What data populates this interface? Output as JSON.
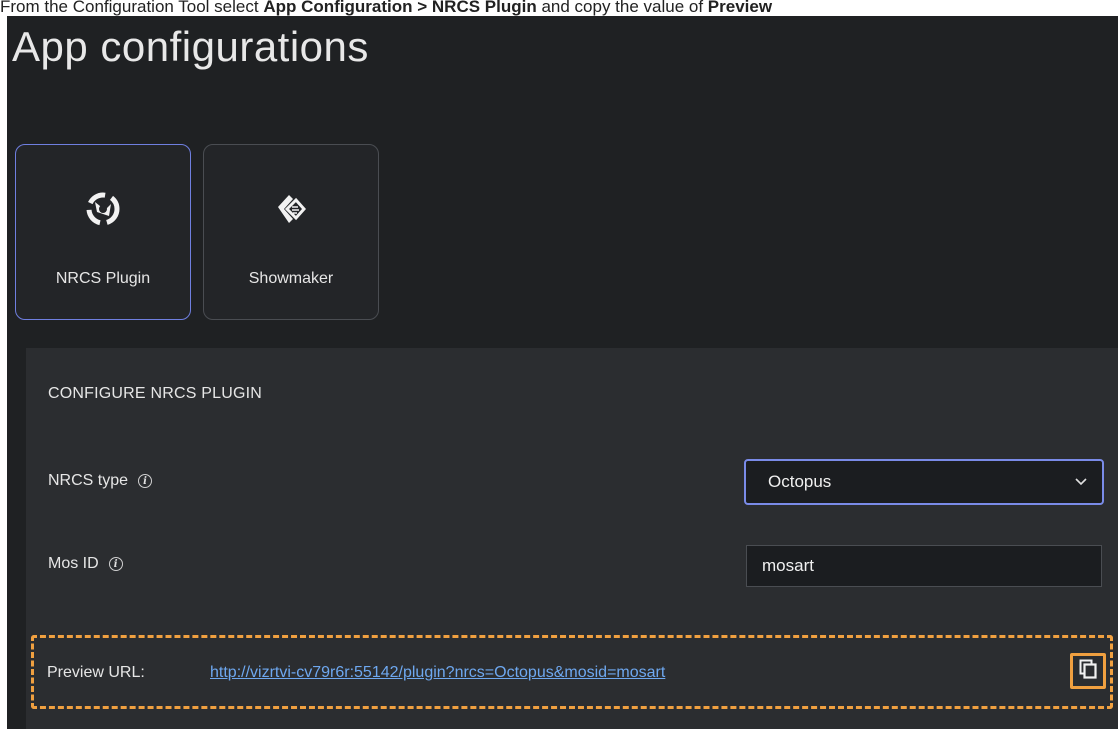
{
  "instruction": {
    "prefix": "From the Configuration Tool select ",
    "path_bold": "App Configuration > NRCS Plugin",
    "middle": " and copy the value of ",
    "target_bold": "Preview"
  },
  "page": {
    "title": "App configurations"
  },
  "apps": [
    {
      "label": "NRCS Plugin",
      "icon": "nrcs-plugin-icon",
      "selected": true
    },
    {
      "label": "Showmaker",
      "icon": "showmaker-icon",
      "selected": false
    }
  ],
  "configure": {
    "section_title": "CONFIGURE NRCS PLUGIN",
    "nrcs_type": {
      "label": "NRCS type",
      "value": "Octopus"
    },
    "mos_id": {
      "label": "Mos ID",
      "value": "mosart"
    },
    "preview": {
      "label": "Preview URL:",
      "url": "http://vizrtvi-cv79r6r:55142/plugin?nrcs=Octopus&mosid=mosart"
    }
  },
  "colors": {
    "background": "#1f2123",
    "panel": "#2b2d30",
    "selected_border": "#6f7fe0",
    "link": "#6ea8f0",
    "highlight": "#f0a040"
  }
}
